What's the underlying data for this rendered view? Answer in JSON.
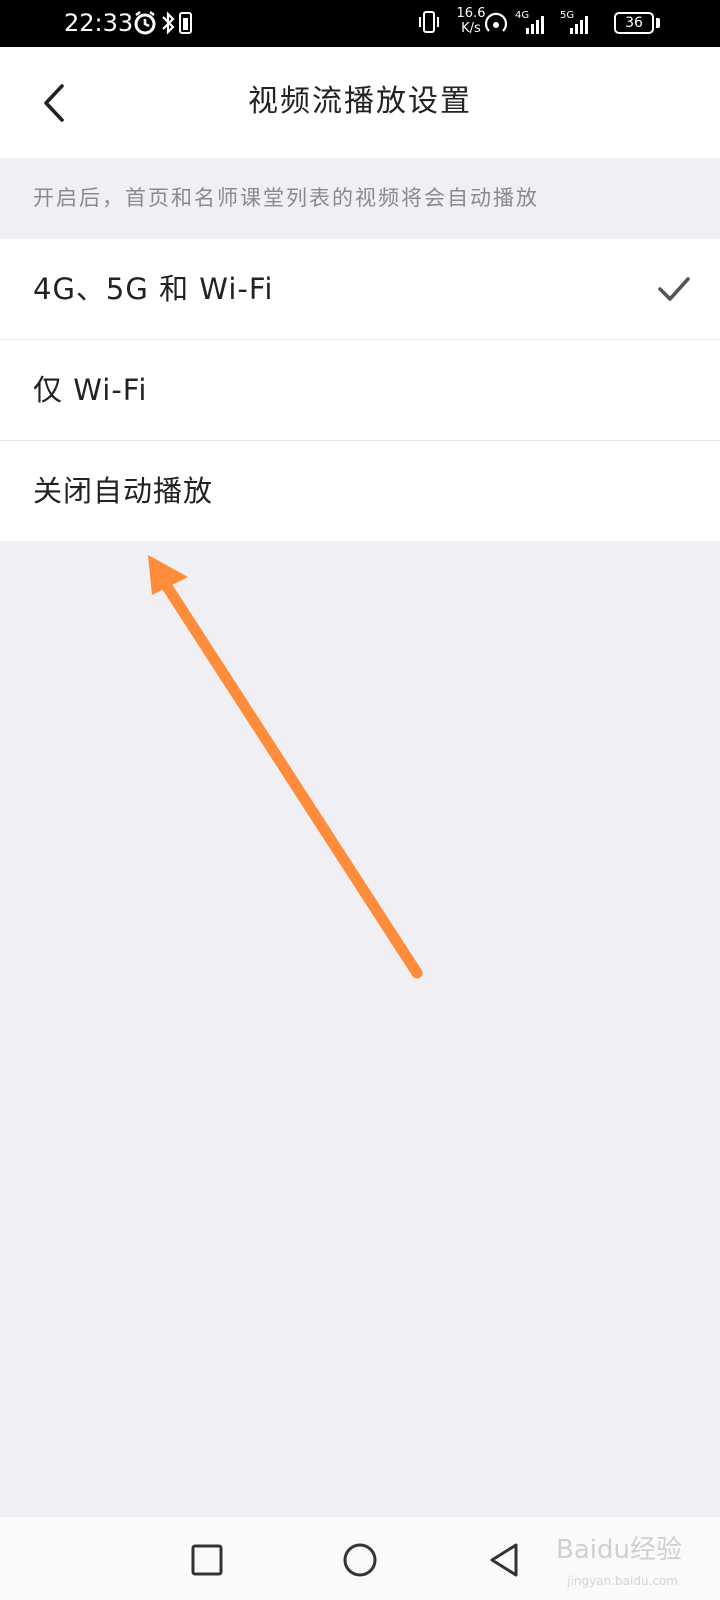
{
  "status_bar": {
    "time": "22:33",
    "net_speed_value": "16.6",
    "net_speed_unit": "K/s",
    "signal1_label": "4G",
    "signal2_label": "5G",
    "battery": "36"
  },
  "header": {
    "title": "视频流播放设置"
  },
  "hint": "开启后，首页和名师课堂列表的视频将会自动播放",
  "options": [
    {
      "label": "4G、5G 和 Wi-Fi",
      "selected": true
    },
    {
      "label": "仅 Wi-Fi",
      "selected": false
    },
    {
      "label": "关闭自动播放",
      "selected": false
    }
  ],
  "watermark": {
    "text": "Baidu经验",
    "sub": "jingyan.baidu.com"
  },
  "colors": {
    "background": "#efeff4",
    "annotation_arrow": "#ff8c3a"
  }
}
